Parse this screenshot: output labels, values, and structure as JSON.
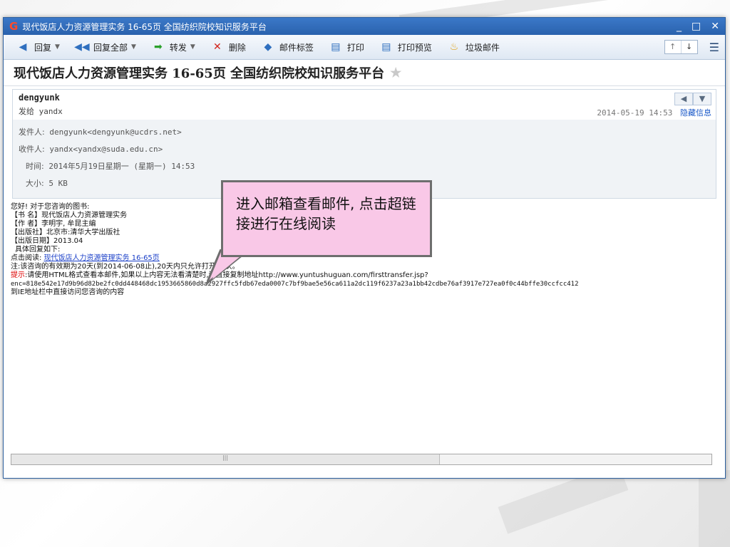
{
  "window": {
    "title": "现代饭店人力资源管理实务  16-65页  全国纺织院校知识服务平台",
    "controls": [
      "_",
      "□",
      "✕"
    ]
  },
  "toolbar": {
    "reply": "回复",
    "reply_all": "回复全部",
    "forward": "转发",
    "delete": "删除",
    "tag": "邮件标签",
    "print": "打印",
    "print_preview": "打印预览",
    "spam": "垃圾邮件"
  },
  "subject": "现代饭店人力资源管理实务  16-65页  全国纺织院校知识服务平台",
  "header": {
    "sender_name": "dengyunk",
    "to_line": "发给 yandx",
    "date": "2014-05-19 14:53",
    "hide_info": "隐藏信息",
    "from_label": "发件人:",
    "from_value": "dengyunk<dengyunk@ucdrs.net>",
    "to_label": "收件人:",
    "to_value": "yandx<yandx@suda.edu.cn>",
    "time_label": "时间:",
    "time_value": "2014年5月19日星期一 (星期一) 14:53",
    "size_label": "大小:",
    "size_value": "5 KB"
  },
  "body": {
    "greeting": "您好! 对于您咨询的图书:",
    "book_name": "【书 名】现代饭店人力资源管理实务",
    "author": "【作 者】李明宇, 牟昆主编",
    "publisher": "【出版社】北京市:清华大学出版社",
    "pub_date": "【出版日期】2013.04",
    "reply_below": "具体回复如下:",
    "read_prefix": "点击阅读: ",
    "read_link": "现代饭店人力资源管理实务  16-65页",
    "note": "注:该咨询的有效期为20天(到2014-06-08止),20天内只允许打开20次。",
    "tip_label": "提示",
    "tip_text": ":请使用HTML格式查看本邮件,如果以上内容无法看清楚时,请直接复制地址http://www.yuntushuguan.com/firsttransfer.jsp?",
    "enc_line": "enc=818e542e17d9b96d82be2fc0dd448468dc1953665860d8a2927ffc5fdb67eda0007c7bf9bae5e56ca611a2dc119f6237a23a1bb42cdbe76af3917e727ea0f0c44bffe30ccfcc412",
    "ie_line": "到IE地址栏中直接访问您咨询的内容"
  },
  "callout": {
    "text": "进入邮箱查看邮件, 点击超链接进行在线阅读"
  }
}
